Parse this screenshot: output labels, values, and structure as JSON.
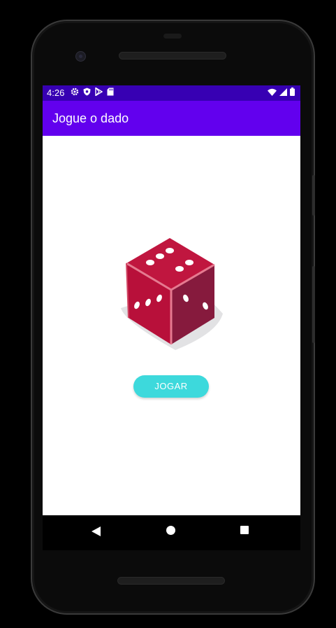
{
  "status_bar": {
    "time": "4:26",
    "left_icons": [
      "settings-icon",
      "shield-icon",
      "play-store-icon",
      "sd-card-icon"
    ],
    "right_icons": [
      "wifi-icon",
      "signal-icon",
      "battery-icon"
    ]
  },
  "app_bar": {
    "title": "Jogue o dado"
  },
  "main": {
    "dice_image": "dice-icon",
    "play_button_label": "JOGAR"
  },
  "nav_bar": {
    "icons": [
      "back-icon",
      "home-icon",
      "recents-icon"
    ]
  },
  "colors": {
    "status_bar": "#3700b3",
    "app_bar": "#6200ee",
    "button": "#3dd9dc",
    "dice_front": "#c0163f",
    "dice_side": "#8a1a3a"
  }
}
